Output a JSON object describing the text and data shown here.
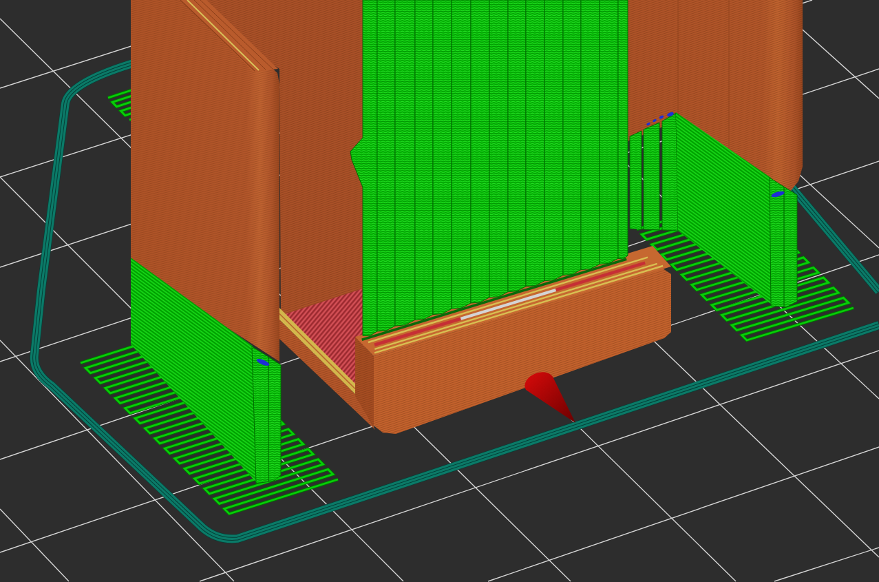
{
  "viewport": {
    "kind": "print-preview"
  }
}
